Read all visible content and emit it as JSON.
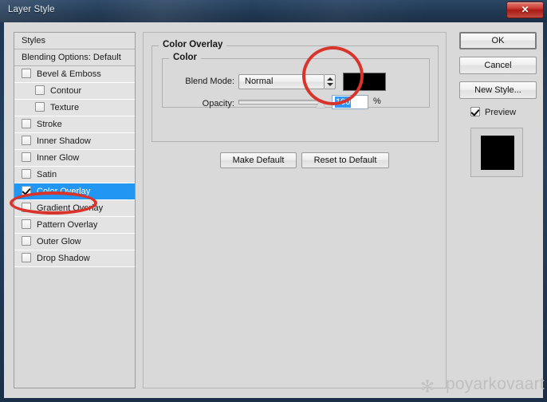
{
  "window": {
    "title": "Layer Style",
    "close_label": "✕"
  },
  "styles_panel": {
    "header": "Styles",
    "blending_options": "Blending Options: Default",
    "effects": [
      {
        "label": "Bevel & Emboss",
        "checked": false,
        "indent": false
      },
      {
        "label": "Contour",
        "checked": false,
        "indent": true
      },
      {
        "label": "Texture",
        "checked": false,
        "indent": true
      },
      {
        "label": "Stroke",
        "checked": false,
        "indent": false
      },
      {
        "label": "Inner Shadow",
        "checked": false,
        "indent": false
      },
      {
        "label": "Inner Glow",
        "checked": false,
        "indent": false
      },
      {
        "label": "Satin",
        "checked": false,
        "indent": false
      },
      {
        "label": "Color Overlay",
        "checked": true,
        "indent": false,
        "selected": true
      },
      {
        "label": "Gradient Overlay",
        "checked": false,
        "indent": false
      },
      {
        "label": "Pattern Overlay",
        "checked": false,
        "indent": false
      },
      {
        "label": "Outer Glow",
        "checked": false,
        "indent": false
      },
      {
        "label": "Drop Shadow",
        "checked": false,
        "indent": false
      }
    ]
  },
  "main": {
    "section_title": "Color Overlay",
    "subsection_title": "Color",
    "blend_mode_label": "Blend Mode:",
    "blend_mode_value": "Normal",
    "color_swatch_hex": "#000000",
    "opacity_label": "Opacity:",
    "opacity_value": "100",
    "opacity_unit": "%",
    "make_default_label": "Make Default",
    "reset_default_label": "Reset to Default"
  },
  "buttons": {
    "ok": "OK",
    "cancel": "Cancel",
    "new_style": "New Style...",
    "preview": "Preview"
  },
  "annotations": {
    "accent_color": "#d9342b"
  },
  "watermark": {
    "text": "poyarkovaart",
    "mark": "✻"
  }
}
